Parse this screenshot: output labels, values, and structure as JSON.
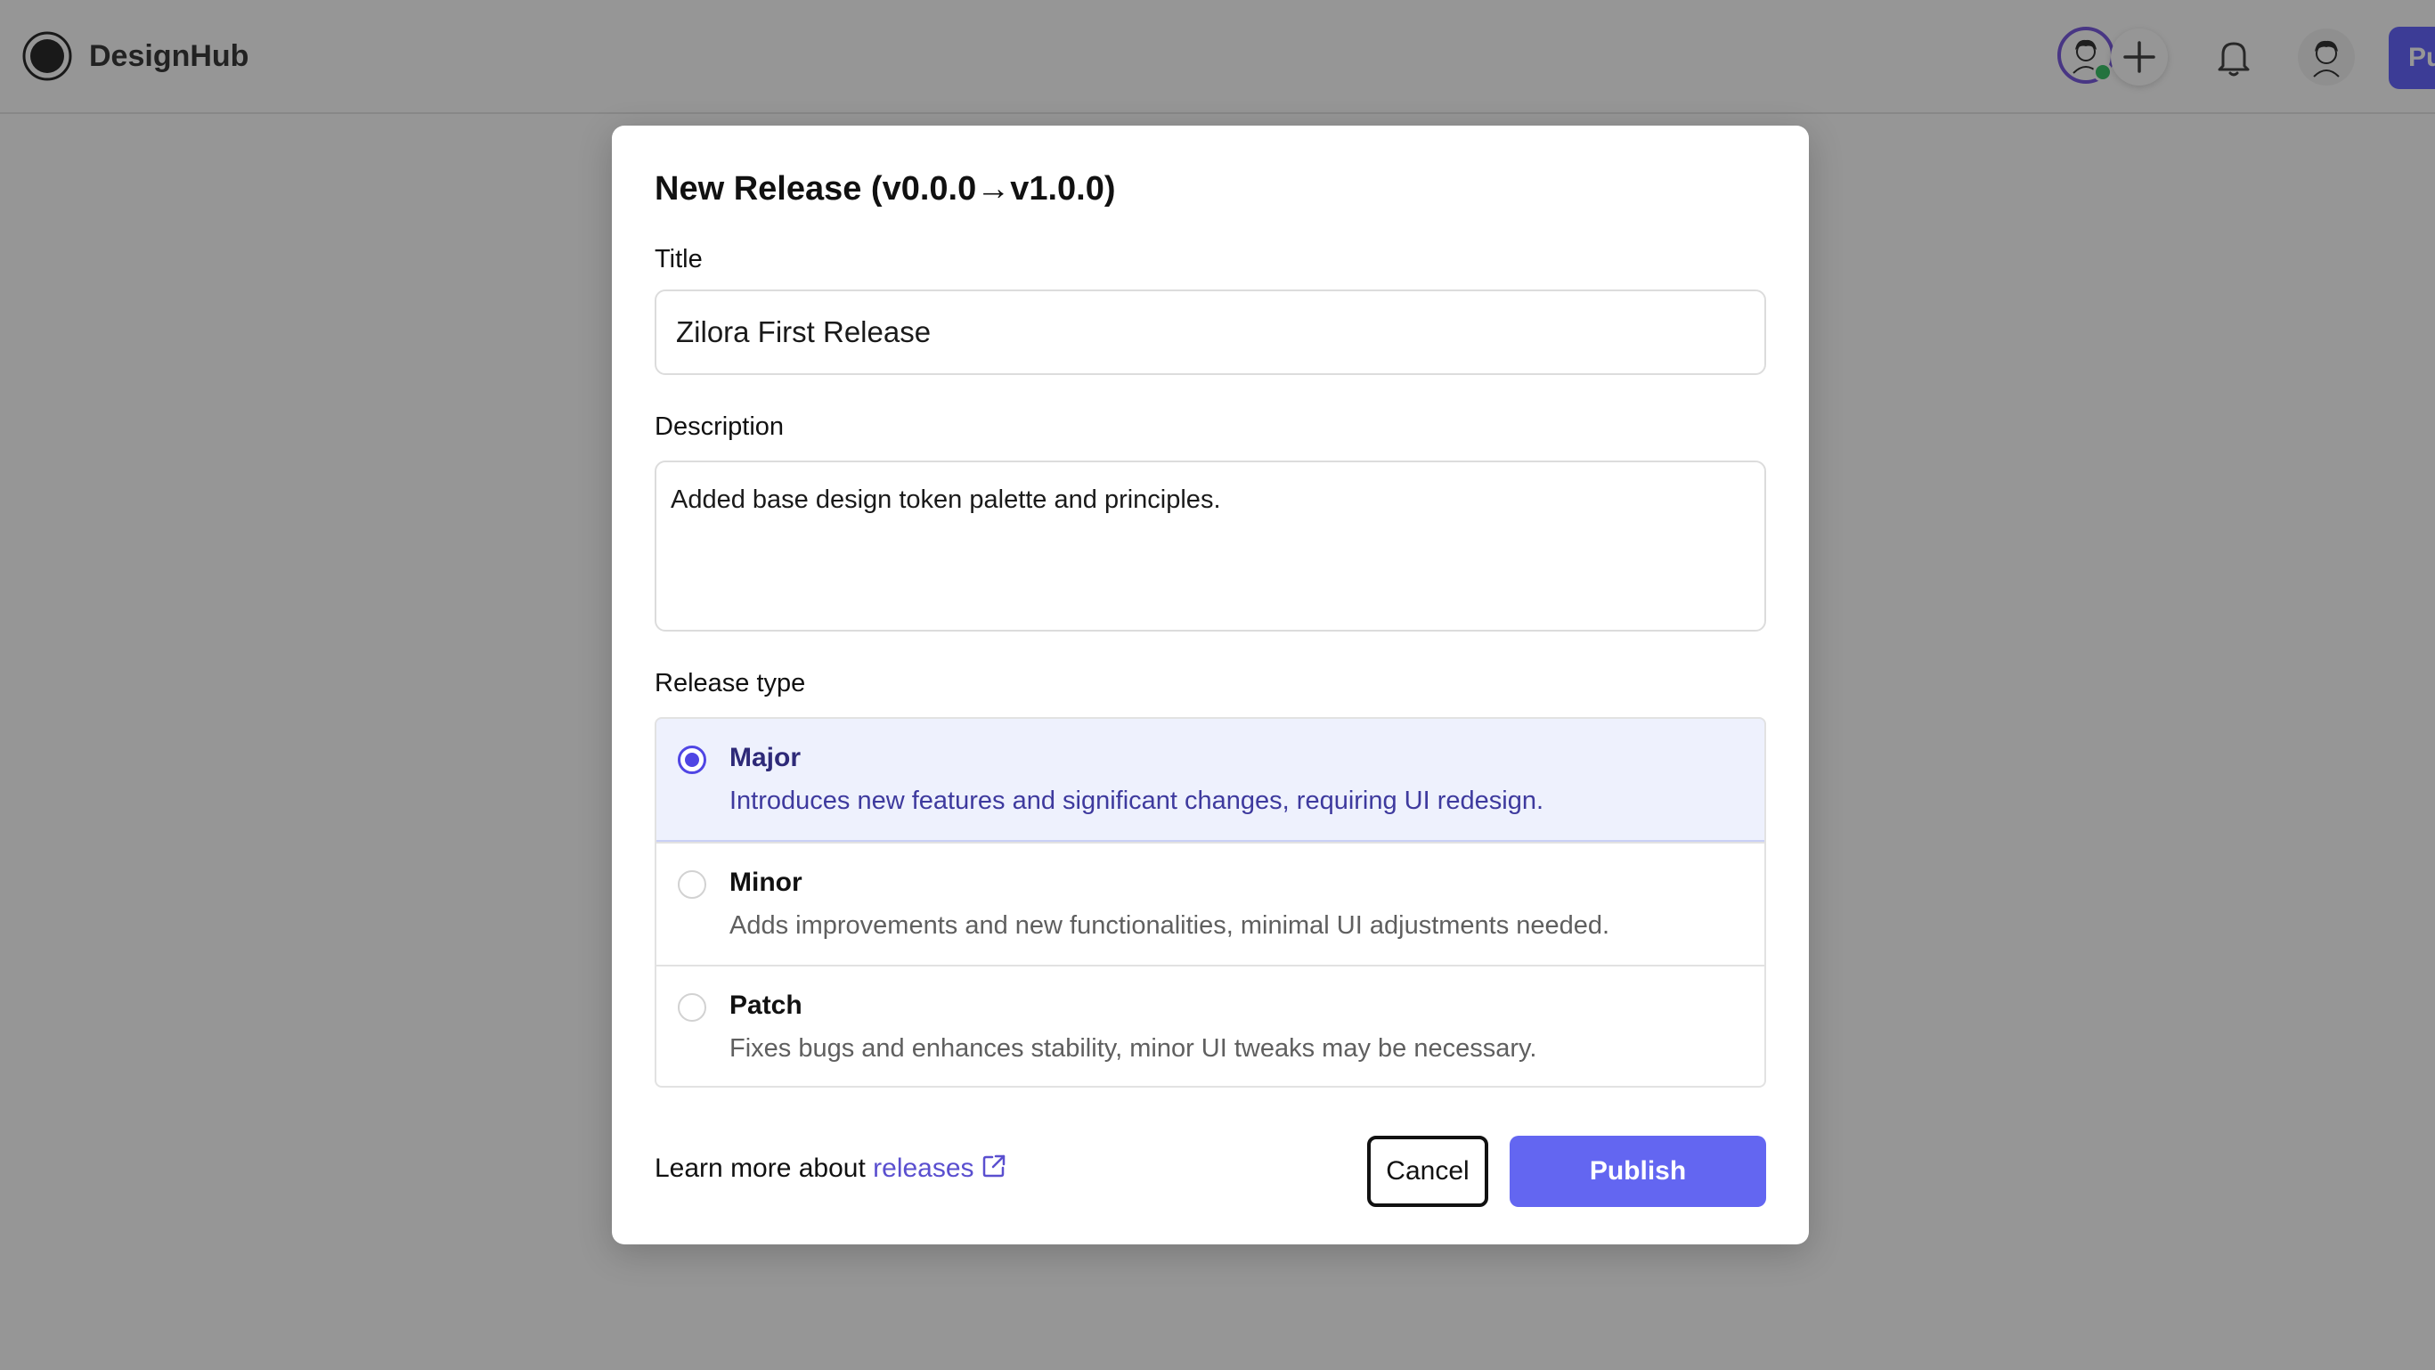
{
  "app": {
    "name": "DesignHub",
    "logo_icon": "ring-logo-icon",
    "top_publish_label": "Pu"
  },
  "topbar": {
    "collaborator_avatar": "avatar-icon",
    "collaborator_status_color": "#3cc36a",
    "add_icon": "plus-icon",
    "notifications_icon": "bell-icon",
    "user_avatar": "avatar-icon"
  },
  "modal": {
    "title": "New Release (v0.0.0→v1.0.0)",
    "title_field": {
      "label": "Title",
      "value": "Zilora First Release"
    },
    "description_field": {
      "label": "Description",
      "value": "Added base design token palette and principles."
    },
    "release_type": {
      "label": "Release type",
      "selected": "Major",
      "options": [
        {
          "name": "Major",
          "description": "Introduces new features and significant changes, requiring UI redesign."
        },
        {
          "name": "Minor",
          "description": "Adds improvements and new functionalities, minimal UI adjustments needed."
        },
        {
          "name": "Patch",
          "description": "Fixes bugs and enhances stability, minor UI tweaks may be necessary."
        }
      ]
    },
    "learn_more": {
      "prefix": "Learn more about ",
      "link_text": "releases",
      "icon": "external-link-icon"
    },
    "cancel_label": "Cancel",
    "publish_label": "Publish"
  },
  "colors": {
    "accent": "#6366f1",
    "selected_bg": "#eef1fd",
    "link": "#5a4fcf",
    "overlay": "rgba(0,0,0,0.41)"
  }
}
